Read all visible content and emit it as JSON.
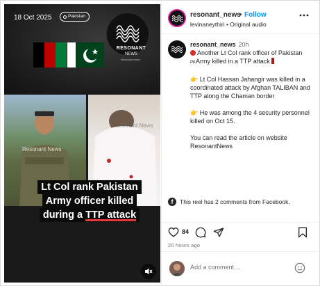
{
  "media": {
    "date": "18 Oct 2025",
    "location_tag": "Pakistan",
    "brand_name": "RESONANT",
    "brand_sub": "NEWS",
    "brand_tagline": "Resonant news ·",
    "watermark": "Resonant News",
    "headline_lines": [
      "Lt Col rank Pakistan",
      "Army officer killed",
      "during a TTP attack"
    ],
    "flag_af_colors": [
      "#000000",
      "#be0000",
      "#007a36"
    ],
    "flag_pk_color": "#01411c",
    "mute_icon": "speaker-muted-icon"
  },
  "header": {
    "username": "resonant_news",
    "dot": "•",
    "follow_label": "Follow",
    "subline": "levinaneythiri • Original audio",
    "more_icon": "more-horizontal-icon"
  },
  "caption": {
    "username": "resonant_news",
    "time": "20h",
    "line1": "Another Lt Col rank officer of Pakistan",
    "line2_prefix": "PK",
    "line2": "Army killed in a TTP attack",
    "para2": "Lt Col Hassan Jahangir was killed in a coordinated attack by Afghan TALIBAN and TTP along the Chaman border",
    "para3": "He was among the 4 security personnel killed on Oct 15.",
    "para4": "You can read the article on website ResonantNews",
    "hand_emoji": "👉"
  },
  "facebook_note": {
    "icon_letter": "f",
    "text": "This reel has 2 comments from Facebook."
  },
  "actions": {
    "likes": "84",
    "time_ago": "20 hours ago",
    "icons": [
      "heart-icon",
      "comment-icon",
      "share-icon",
      "bookmark-icon"
    ]
  },
  "comment": {
    "placeholder": "Add a comment…"
  },
  "colors": {
    "accent_blue": "#0095f6",
    "text": "#262626",
    "muted": "#737373",
    "border": "#dbdbdb"
  }
}
